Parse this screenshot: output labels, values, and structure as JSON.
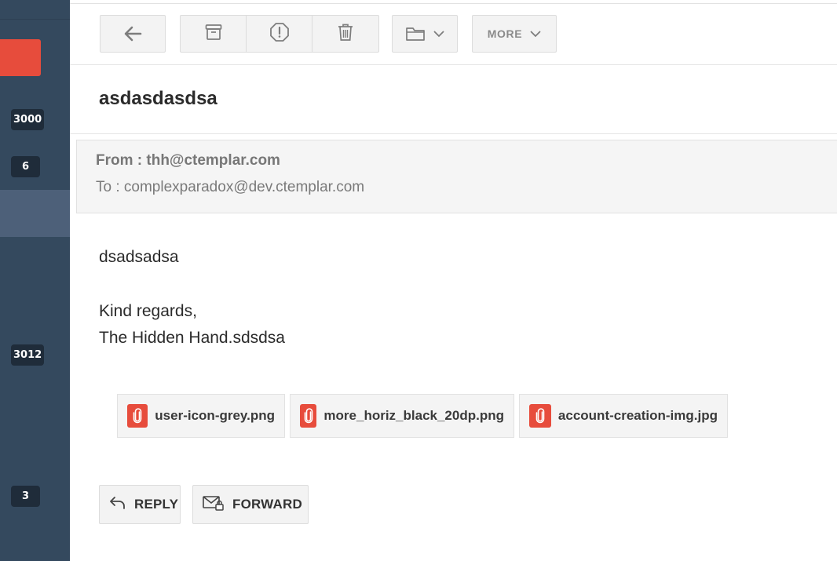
{
  "sidebar": {
    "badges": [
      "3000",
      "6",
      "3012",
      "3"
    ]
  },
  "toolbar": {
    "icons": {
      "back": "arrow-left-icon",
      "archive": "archive-icon",
      "spam": "spam-alert-icon",
      "delete": "trash-icon",
      "move": "folder-icon",
      "chevron": "chevron-down-icon"
    },
    "more_label": "MORE"
  },
  "message": {
    "subject": "asdasdasdsa",
    "from": "From : thh@ctemplar.com",
    "to": "To : complexparadox@dev.ctemplar.com",
    "body_lines": [
      "dsadsadsa",
      "Kind regards,",
      "The Hidden Hand.sdsdsa"
    ]
  },
  "attachments": [
    {
      "name": "user-icon-grey.png"
    },
    {
      "name": "more_horiz_black_20dp.png"
    },
    {
      "name": "account-creation-img.jpg"
    }
  ],
  "actions": {
    "reply_label": "REPLY",
    "forward_label": "FORWARD"
  },
  "colors": {
    "sidebar": "#34495e",
    "accent": "#e74c3c"
  }
}
